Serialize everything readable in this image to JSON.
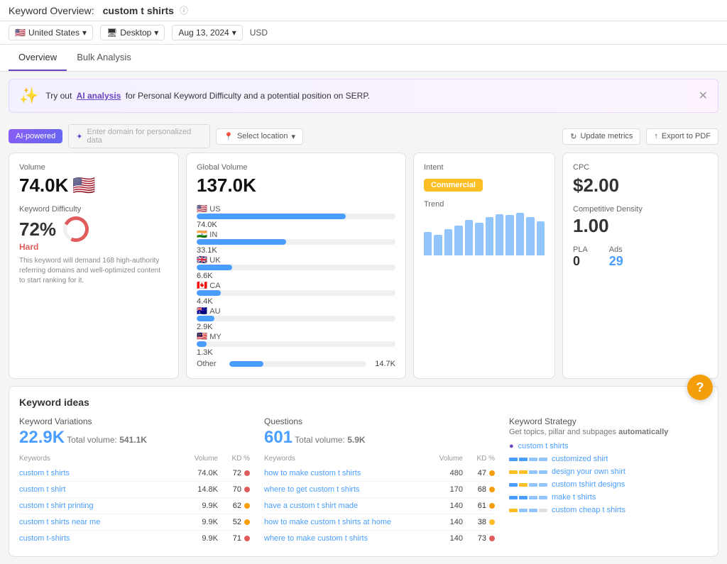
{
  "header": {
    "title_prefix": "Keyword Overview:",
    "title_keyword": "custom t shirts",
    "info_icon": "ⓘ"
  },
  "filters": {
    "country": "United States",
    "country_flag": "🇺🇸",
    "device": "Desktop",
    "date": "Aug 13, 2024",
    "currency": "USD"
  },
  "tabs": [
    {
      "label": "Overview",
      "active": true
    },
    {
      "label": "Bulk Analysis",
      "active": false
    }
  ],
  "ai_banner": {
    "text_before": "Try out",
    "link_text": "AI analysis",
    "text_after": "for Personal Keyword Difficulty and a potential position on SERP."
  },
  "toolbar": {
    "ai_powered": "AI-powered",
    "domain_placeholder": "Enter domain for personalized data",
    "location_placeholder": "Select location",
    "update_metrics": "Update metrics",
    "export_pdf": "Export to PDF"
  },
  "metrics": {
    "volume": {
      "label": "Volume",
      "value": "74.0K",
      "flag": "🇺🇸"
    },
    "keyword_difficulty": {
      "label": "Keyword Difficulty",
      "value": "72%",
      "level": "Hard",
      "description": "This keyword will demand 168 high-authority referring domains and well-optimized content to start ranking for it.",
      "percent": 72
    },
    "global_volume": {
      "label": "Global Volume",
      "value": "137.0K",
      "countries": [
        {
          "flag": "🇺🇸",
          "code": "US",
          "value": "74.0K",
          "bar_pct": 75
        },
        {
          "flag": "🇮🇳",
          "code": "IN",
          "value": "33.1K",
          "bar_pct": 45
        },
        {
          "flag": "🇬🇧",
          "code": "UK",
          "value": "6.6K",
          "bar_pct": 18
        },
        {
          "flag": "🇨🇦",
          "code": "CA",
          "value": "4.4K",
          "bar_pct": 12
        },
        {
          "flag": "🇦🇺",
          "code": "AU",
          "value": "2.9K",
          "bar_pct": 9
        },
        {
          "flag": "🇲🇾",
          "code": "MY",
          "value": "1.3K",
          "bar_pct": 5
        }
      ],
      "other_label": "Other",
      "other_value": "14.7K",
      "other_pct": 25
    },
    "intent": {
      "label": "Intent",
      "badge": "Commercial"
    },
    "trend": {
      "label": "Trend",
      "bars": [
        40,
        35,
        45,
        50,
        60,
        55,
        65,
        70,
        68,
        72,
        65,
        58
      ]
    },
    "cpc": {
      "label": "CPC",
      "value": "$2.00"
    },
    "competitive_density": {
      "label": "Competitive Density",
      "value": "1.00"
    },
    "pla": {
      "label": "PLA",
      "value": "0"
    },
    "ads": {
      "label": "Ads",
      "value": "29"
    }
  },
  "keyword_ideas": {
    "section_title": "Keyword ideas",
    "variations": {
      "label": "Keyword Variations",
      "count": "22.9K",
      "total_label": "Total volume:",
      "total_value": "541.1K",
      "headers": [
        "Keywords",
        "Volume",
        "KD %"
      ],
      "rows": [
        {
          "keyword": "custom t shirts",
          "volume": "74.0K",
          "kd": "72",
          "dot": "red"
        },
        {
          "keyword": "custom t shirt",
          "volume": "14.8K",
          "kd": "70",
          "dot": "red"
        },
        {
          "keyword": "custom t shirt printing",
          "volume": "9.9K",
          "kd": "62",
          "dot": "orange"
        },
        {
          "keyword": "custom t shirts near me",
          "volume": "9.9K",
          "kd": "52",
          "dot": "orange"
        },
        {
          "keyword": "custom t-shirts",
          "volume": "9.9K",
          "kd": "71",
          "dot": "red"
        }
      ]
    },
    "questions": {
      "label": "Questions",
      "count": "601",
      "total_label": "Total volume:",
      "total_value": "5.9K",
      "headers": [
        "Keywords",
        "Volume",
        "KD %"
      ],
      "rows": [
        {
          "keyword": "how to make custom t shirts",
          "volume": "480",
          "kd": "47",
          "dot": "orange"
        },
        {
          "keyword": "where to get custom t shirts",
          "volume": "170",
          "kd": "68",
          "dot": "orange"
        },
        {
          "keyword": "have a custom t shirt made",
          "volume": "140",
          "kd": "61",
          "dot": "orange"
        },
        {
          "keyword": "how to make custom t shirts at home",
          "volume": "140",
          "kd": "38",
          "dot": "yellow"
        },
        {
          "keyword": "where to make custom t shirts",
          "volume": "140",
          "kd": "73",
          "dot": "red"
        }
      ]
    },
    "strategy": {
      "label": "Keyword Strategy",
      "description_before": "Get topics, pillar and subpages",
      "description_em": "automatically",
      "root": "custom t shirts",
      "items": [
        {
          "keyword": "customized shirt",
          "colors": [
            "#4a9eff",
            "#4a9eff",
            "#93c5fd",
            "#93c5fd"
          ]
        },
        {
          "keyword": "design your own shirt",
          "colors": [
            "#fbbf24",
            "#fbbf24",
            "#93c5fd",
            "#93c5fd"
          ]
        },
        {
          "keyword": "custom tshirt designs",
          "colors": [
            "#4a9eff",
            "#fbbf24",
            "#93c5fd",
            "#93c5fd"
          ]
        },
        {
          "keyword": "make t shirts",
          "colors": [
            "#4a9eff",
            "#4a9eff",
            "#93c5fd",
            "#93c5fd"
          ]
        },
        {
          "keyword": "custom cheap t shirts",
          "colors": [
            "#fbbf24",
            "#93c5fd",
            "#93c5fd",
            "#e0e0e0"
          ]
        }
      ]
    }
  },
  "help_btn": "?"
}
